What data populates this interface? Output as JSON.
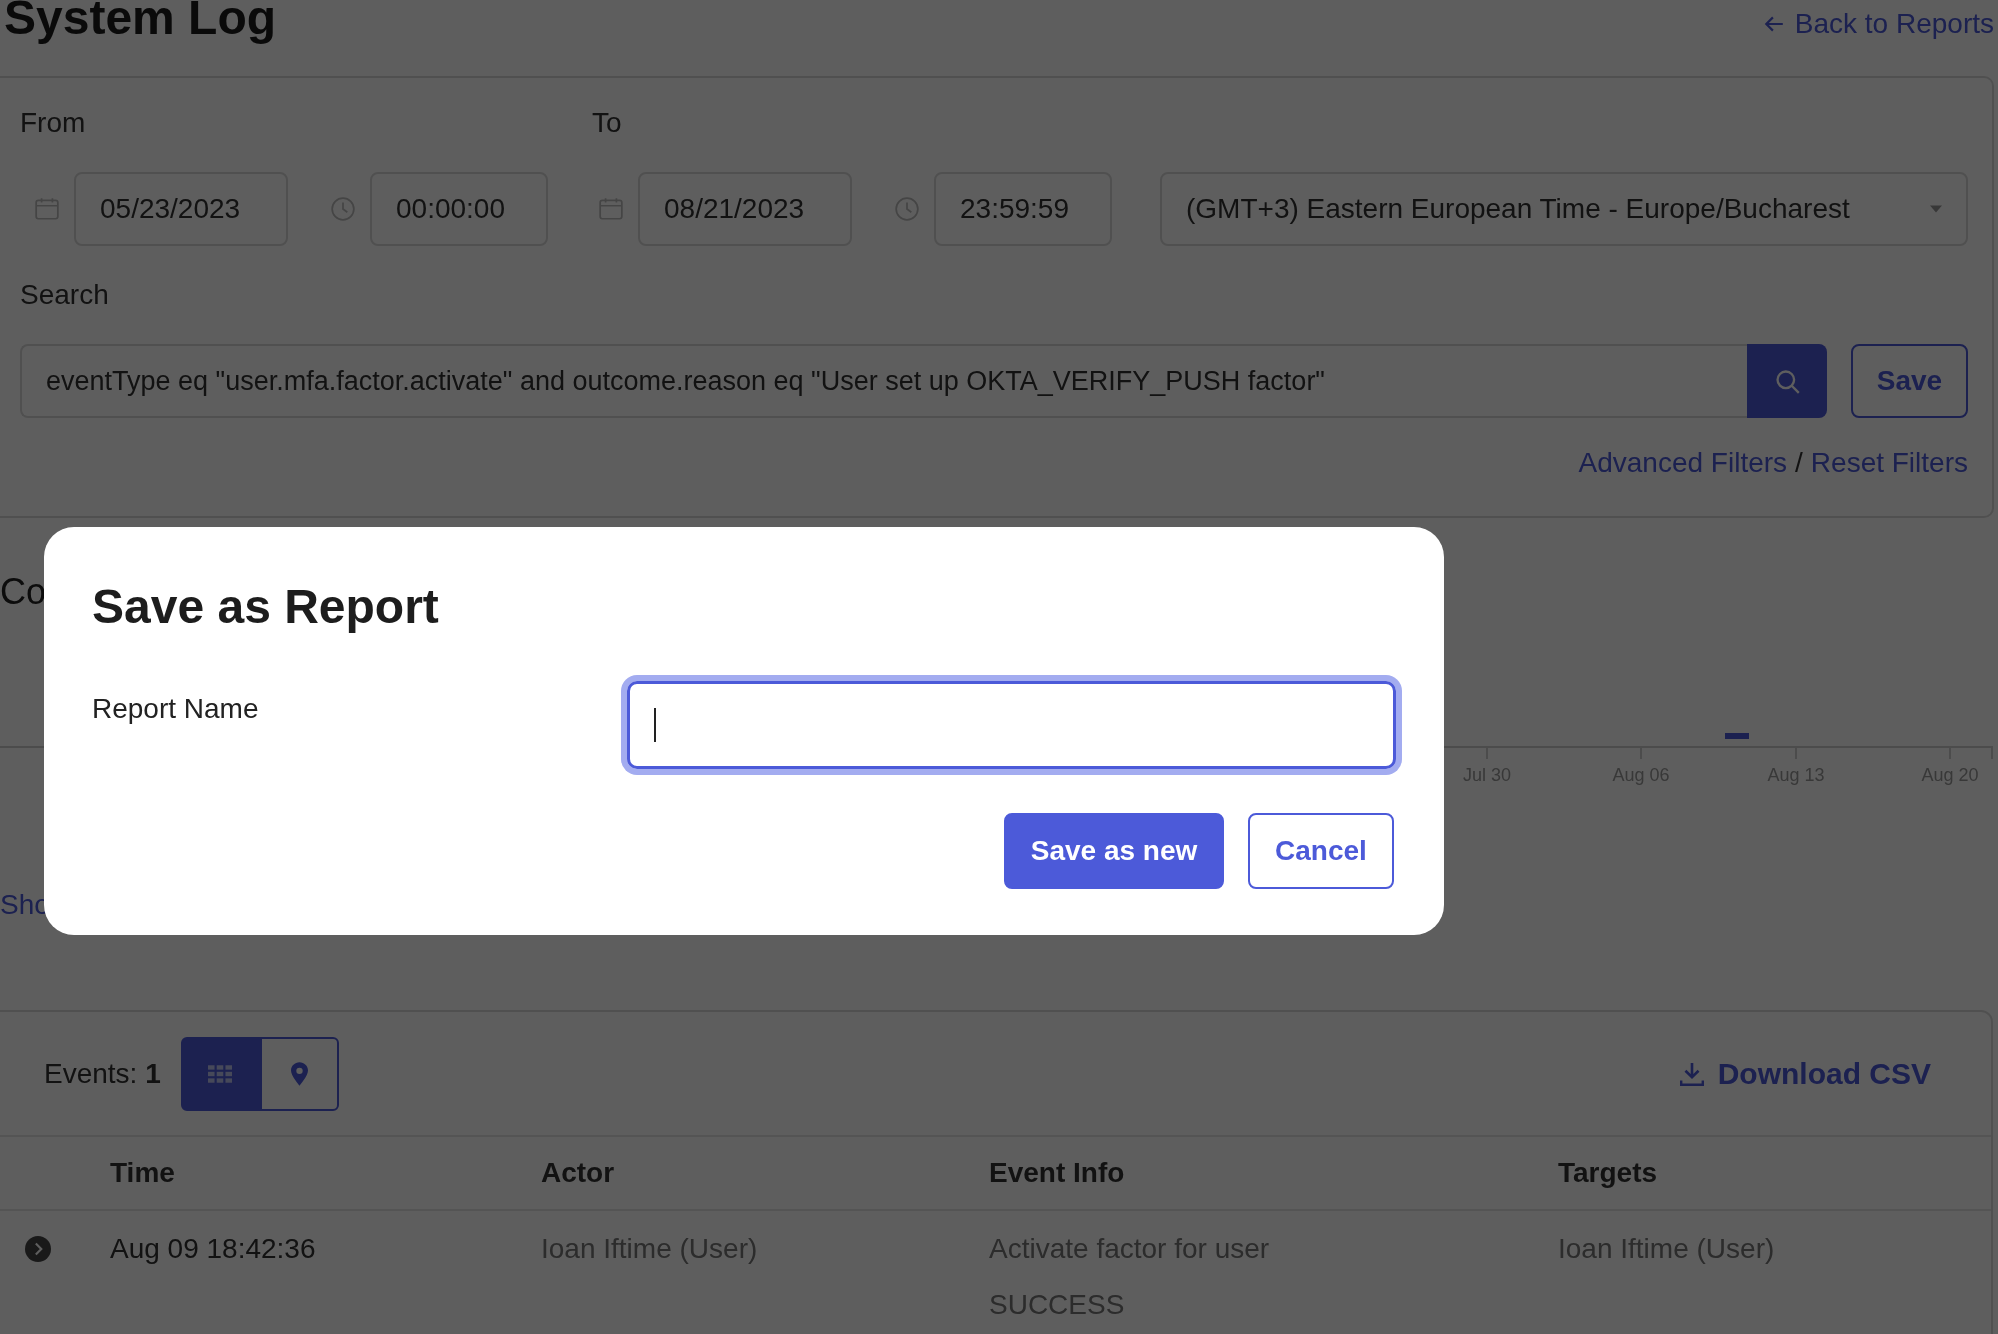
{
  "page": {
    "title": "System Log",
    "back_link": "Back to Reports"
  },
  "filters": {
    "from_label": "From",
    "to_label": "To",
    "from_date": "05/23/2023",
    "from_time": "00:00:00",
    "to_date": "08/21/2023",
    "to_time": "23:59:59",
    "timezone": "(GMT+3) Eastern European Time - Europe/Bucharest",
    "search_label": "Search",
    "search_value": "eventType eq \"user.mfa.factor.activate\" and outcome.reason eq \"User set up OKTA_VERIFY_PUSH factor\"",
    "save_button": "Save",
    "advanced_filters": "Advanced Filters",
    "separator": "/",
    "reset_filters": "Reset Filters"
  },
  "chart": {
    "heading": "Co",
    "x_labels": [
      "Jul 30",
      "Aug 06",
      "Aug 13",
      "Aug 20"
    ],
    "link": "Sho"
  },
  "events": {
    "label": "Events:",
    "count": "1",
    "download": "Download CSV",
    "view_toggle": [
      {
        "kind": "grid",
        "selected": true
      },
      {
        "kind": "map",
        "selected": false
      }
    ]
  },
  "table": {
    "columns": [
      "Time",
      "Actor",
      "Event Info",
      "Targets"
    ],
    "rows": [
      {
        "expanded": false,
        "time": "Aug 09 18:42:36",
        "actor": "Ioan Iftime (User)",
        "event_info": [
          "Activate factor for user",
          "SUCCESS"
        ],
        "targets": "Ioan Iftime  (User)"
      }
    ]
  },
  "modal": {
    "title": "Save as Report",
    "field_label": "Report Name",
    "buttons": [
      {
        "label": "Save as new",
        "kind": "primary"
      },
      {
        "label": "Cancel",
        "kind": "secondary"
      }
    ]
  }
}
